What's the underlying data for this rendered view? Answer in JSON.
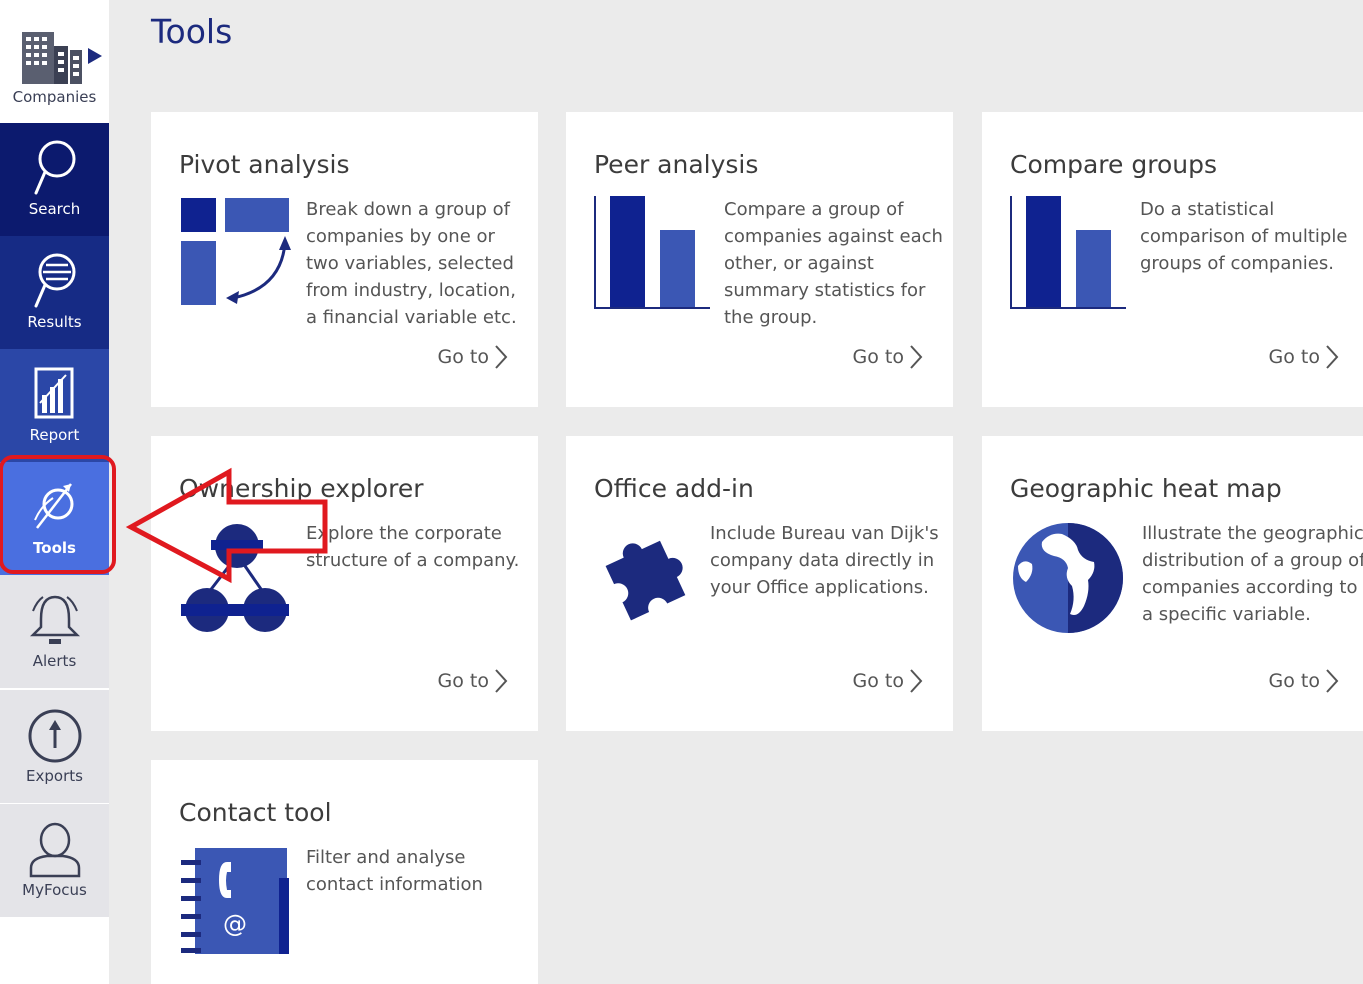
{
  "page": {
    "title": "Tools"
  },
  "sidebar": {
    "brand_label": "Companies",
    "items": [
      {
        "label": "Search",
        "icon": "search-icon"
      },
      {
        "label": "Results",
        "icon": "results-icon"
      },
      {
        "label": "Report",
        "icon": "report-icon"
      },
      {
        "label": "Tools",
        "icon": "tools-icon",
        "active": true
      },
      {
        "label": "Alerts",
        "icon": "bell-icon"
      },
      {
        "label": "Exports",
        "icon": "upload-icon"
      },
      {
        "label": "MyFocus",
        "icon": "user-icon"
      }
    ]
  },
  "cards": [
    {
      "title": "Pivot analysis",
      "description": "Break down a group of companies by one or two variables, selected from industry, location, a financial variable etc.",
      "goto": "Go to",
      "icon": "pivot-icon"
    },
    {
      "title": "Peer analysis",
      "description": "Compare a group of companies against each other, or against summary statistics for the group.",
      "goto": "Go to",
      "icon": "bar-chart-icon"
    },
    {
      "title": "Compare groups",
      "description": "Do a statistical comparison of multiple groups of companies.",
      "goto": "Go to",
      "icon": "bar-chart-icon"
    },
    {
      "title": "Ownership explorer",
      "description": "Explore the corporate structure of a company.",
      "goto": "Go to",
      "icon": "org-tree-icon"
    },
    {
      "title": "Office add-in",
      "description": "Include Bureau van Dijk's company data directly in your Office applications.",
      "goto": "Go to",
      "icon": "puzzle-icon"
    },
    {
      "title": "Geographic heat map",
      "description": "Illustrate the geographic distribution of a group of companies according to a specific variable.",
      "goto": "Go to",
      "icon": "globe-icon"
    },
    {
      "title": "Contact tool",
      "description": "Filter and analyse contact information",
      "goto": "Go to",
      "icon": "address-book-icon"
    }
  ],
  "colors": {
    "primary": "#1c2a7e",
    "accent": "#2f4aa8",
    "annotation": "#e0191f"
  }
}
